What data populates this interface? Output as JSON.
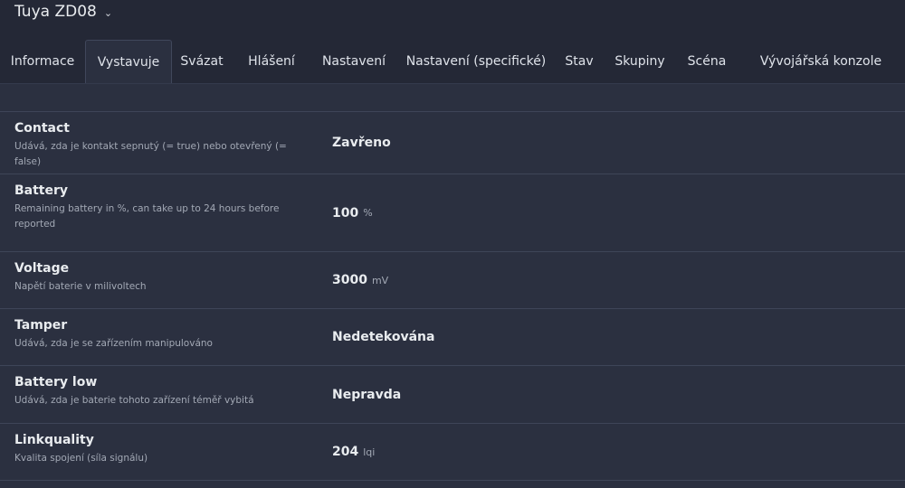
{
  "device": {
    "title": "Tuya ZD08",
    "chevron": "⌄"
  },
  "tabs": [
    {
      "label": "Informace",
      "active": false
    },
    {
      "label": "Vystavuje",
      "active": true
    },
    {
      "label": "Svázat",
      "active": false
    },
    {
      "label": "Hlášení",
      "active": false
    },
    {
      "label": "Nastavení",
      "active": false
    },
    {
      "label": "Nastavení (specifické)",
      "active": false
    },
    {
      "label": "Stav",
      "active": false
    },
    {
      "label": "Skupiny",
      "active": false
    },
    {
      "label": "Scéna",
      "active": false
    },
    {
      "label": "Vývojářská konzole",
      "active": false
    }
  ],
  "exposes": [
    {
      "name": "Contact",
      "description": "Udává, zda je kontakt sepnutý (= true) nebo otevřený (= false)",
      "value": "Zavřeno",
      "unit": ""
    },
    {
      "name": "Battery",
      "description": "Remaining battery in %, can take up to 24 hours before reported",
      "value": "100",
      "unit": "%"
    },
    {
      "name": "Voltage",
      "description": "Napětí baterie v milivoltech",
      "value": "3000",
      "unit": "mV"
    },
    {
      "name": "Tamper",
      "description": "Udává, zda je se zařízením manipulováno",
      "value": "Nedetekována",
      "unit": ""
    },
    {
      "name": "Battery low",
      "description": "Udává, zda je baterie tohoto zařízení téměř vybitá",
      "value": "Nepravda",
      "unit": ""
    },
    {
      "name": "Linkquality",
      "description": "Kvalita spojení (síla signálu)",
      "value": "204",
      "unit": "lqi"
    }
  ]
}
